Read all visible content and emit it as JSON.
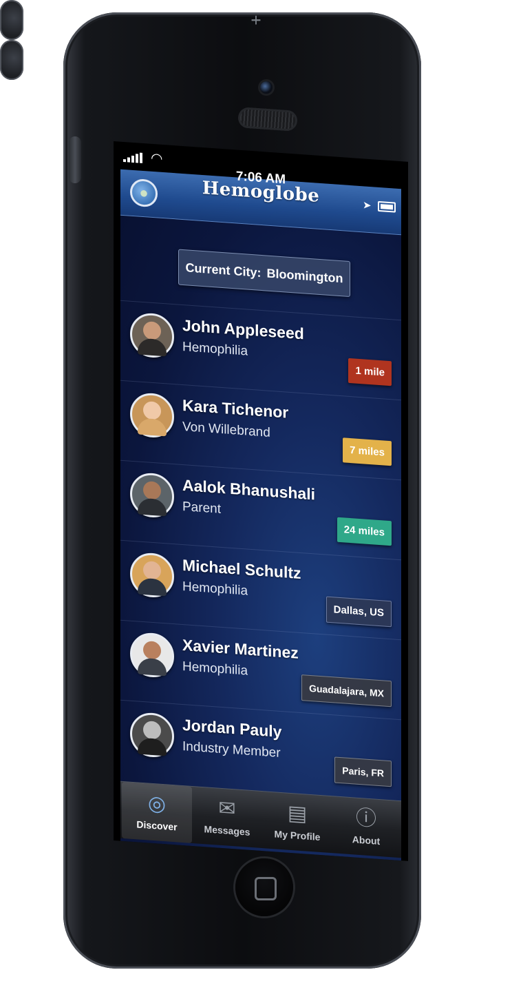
{
  "status_bar": {
    "time": "7:06 AM"
  },
  "app": {
    "title": "Hemoglobe"
  },
  "city": {
    "label": "Current City:",
    "value": "Bloomington"
  },
  "people": [
    {
      "name": "John Appleseed",
      "condition": "Hemophilia",
      "distance": "1 mile",
      "badge_color": "#b0341f"
    },
    {
      "name": "Kara Tichenor",
      "condition": "Von Willebrand",
      "distance": "7 miles",
      "badge_color": "#e3b24a"
    },
    {
      "name": "Aalok Bhanushali",
      "condition": "Parent",
      "distance": "24 miles",
      "badge_color": "#2fa889"
    },
    {
      "name": "Michael Schultz",
      "condition": "Hemophilia",
      "distance": "Dallas, US",
      "badge_color": "#2d3855"
    },
    {
      "name": "Xavier Martinez",
      "condition": "Hemophilia",
      "distance": "Guadalajara, MX",
      "badge_color": "#373a42"
    },
    {
      "name": "Jordan Pauly",
      "condition": "Industry Member",
      "distance": "Paris, FR",
      "badge_color": "#373a42"
    }
  ],
  "tabs": [
    {
      "label": "Discover",
      "icon": "radar-icon",
      "active": true
    },
    {
      "label": "Messages",
      "icon": "envelope-icon",
      "active": false
    },
    {
      "label": "My Profile",
      "icon": "profile-card-icon",
      "active": false
    },
    {
      "label": "About",
      "icon": "info-icon",
      "active": false
    }
  ]
}
